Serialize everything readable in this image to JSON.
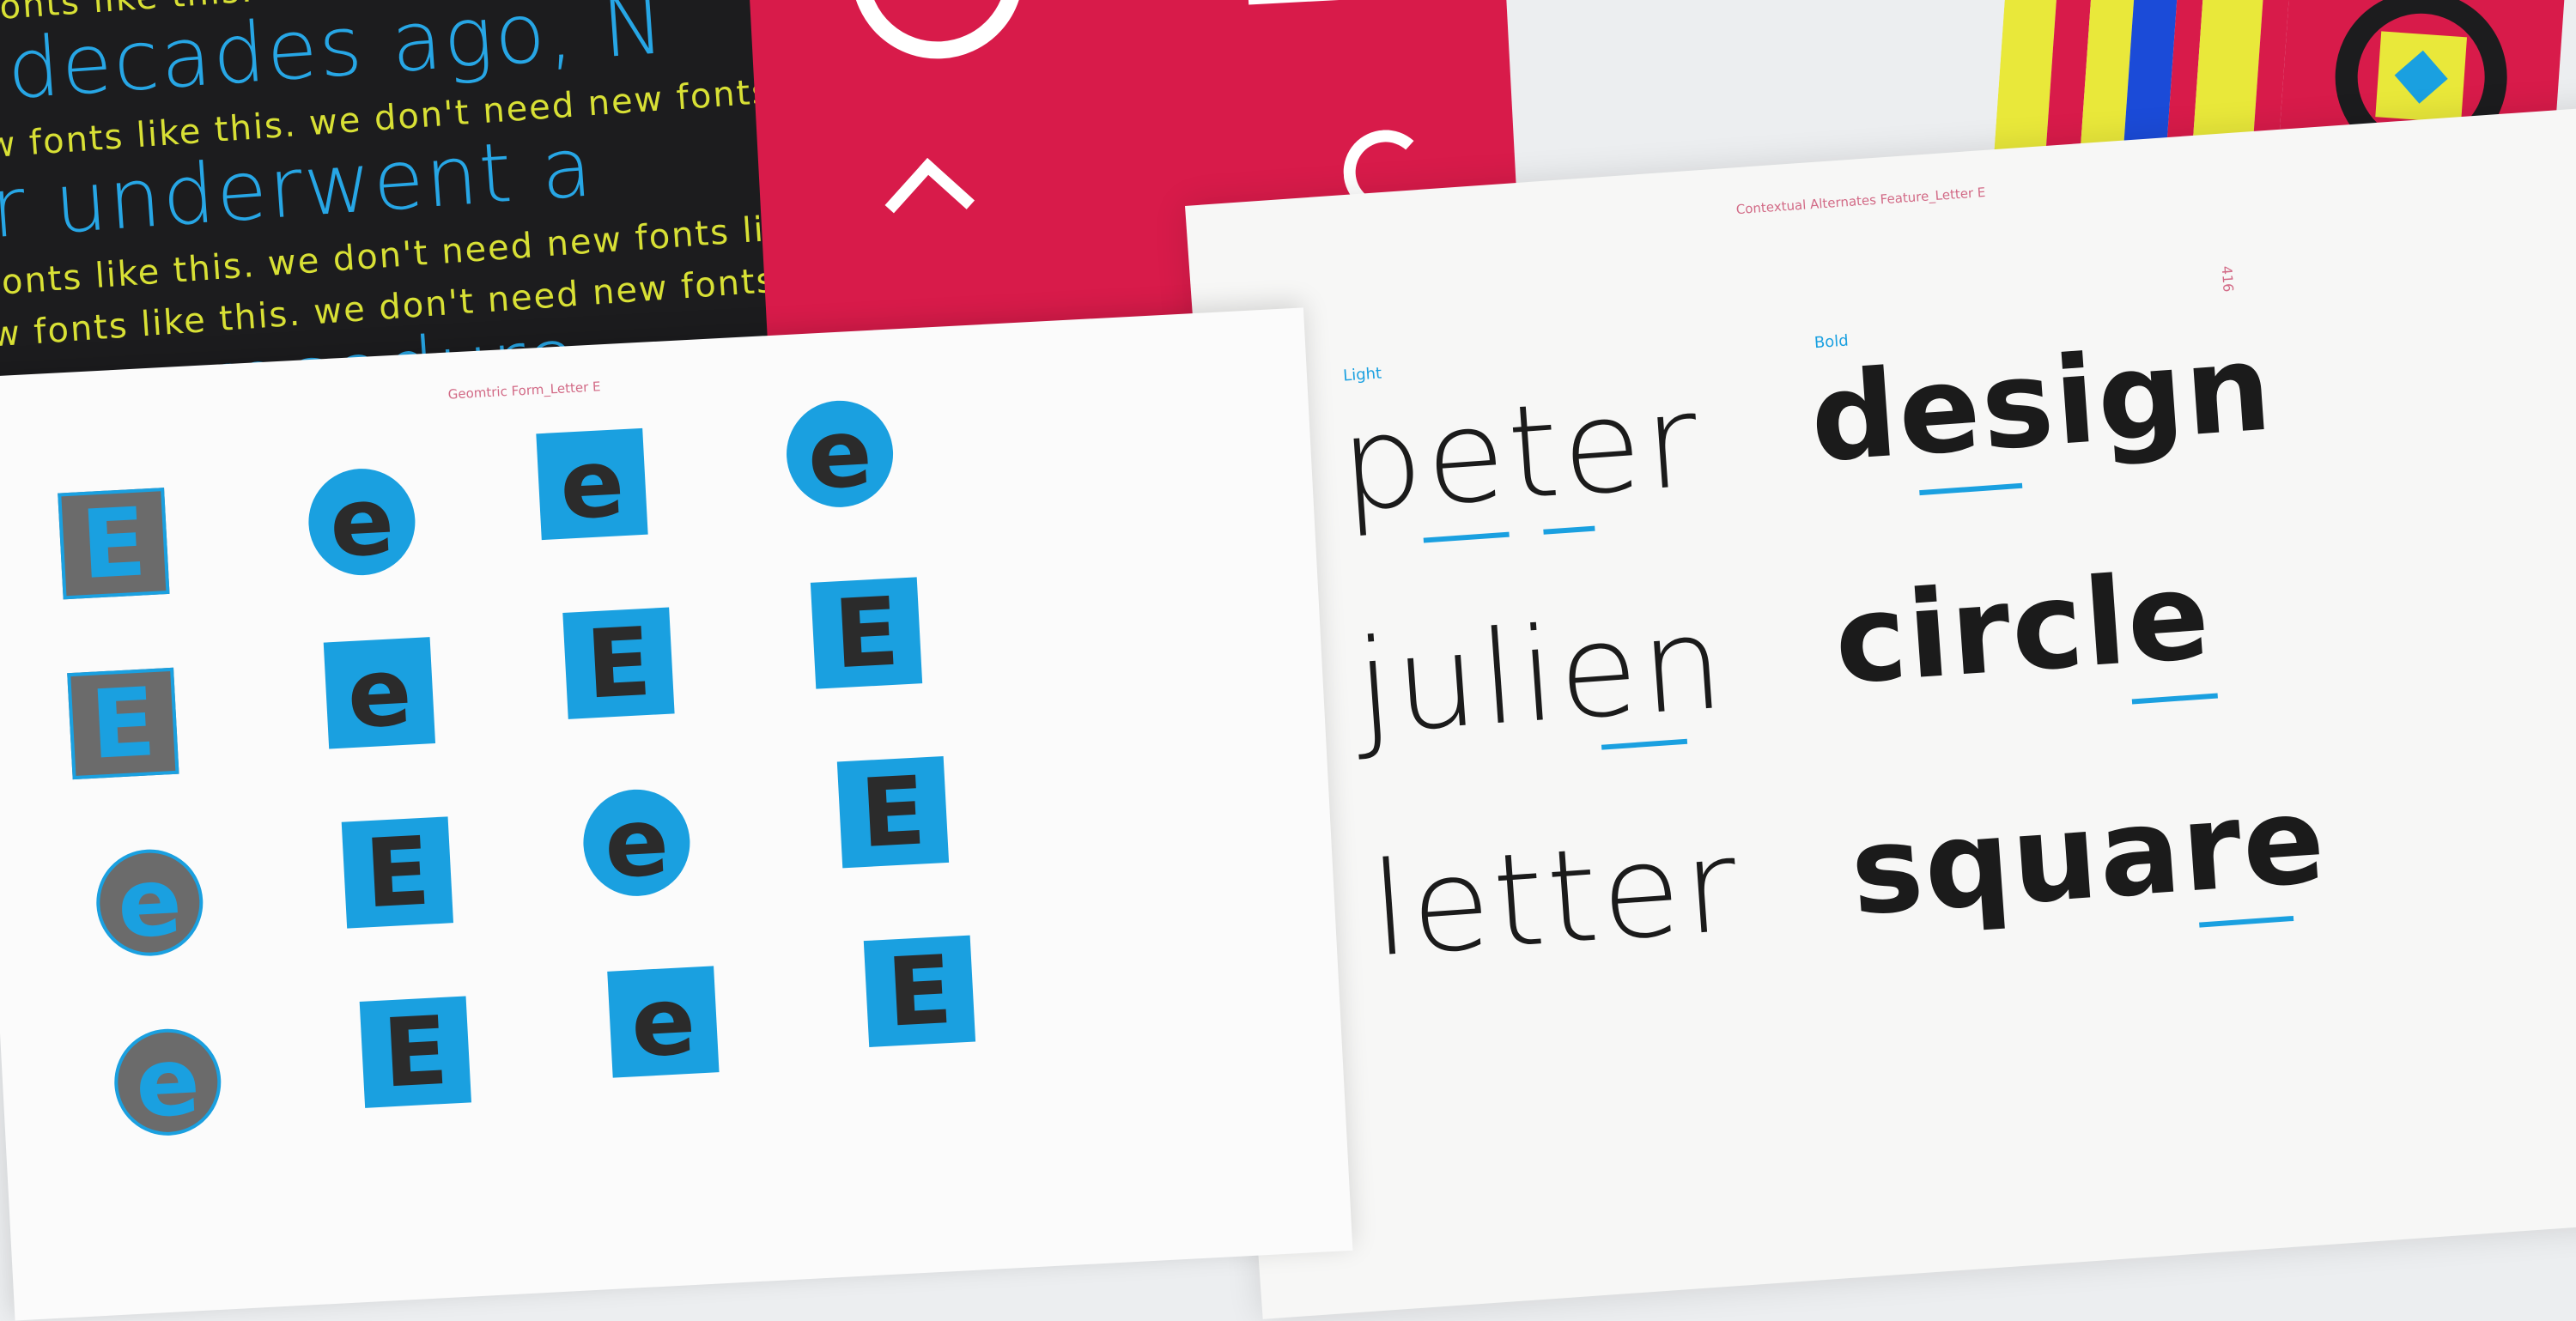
{
  "dark_sheet": {
    "lines": [
      {
        "text": "fonts like this. we don't need new fonts like this.",
        "kind": "small"
      },
      {
        "text": "decades ago, N",
        "kind": "big"
      },
      {
        "text": "w fonts like this. we don't need new fonts like this.",
        "kind": "small"
      },
      {
        "text": "r underwent a",
        "kind": "big"
      },
      {
        "text": "fonts like this. we don't need new fonts like this.",
        "kind": "small"
      },
      {
        "text": "w fonts like this. we don't need new fonts like this.",
        "kind": "small"
      },
      {
        "text": "ew procedure",
        "kind": "big"
      }
    ]
  },
  "left_page": {
    "caption": "Geomtric Form_Letter E",
    "glyph": "e",
    "glyph_upper": "E"
  },
  "right_page": {
    "caption": "Contextual Alternates Feature_Letter E",
    "page_number": "416",
    "light_label": "Light",
    "bold_label": "Bold",
    "light_words": [
      "peter",
      "julien",
      "letter"
    ],
    "bold_words": [
      "design",
      "circle",
      "square"
    ]
  },
  "colors": {
    "accent_blue": "#1aa0e0",
    "magenta": "#d81b4a",
    "yellow": "#e9e83a",
    "dark": "#1c1c1e"
  }
}
